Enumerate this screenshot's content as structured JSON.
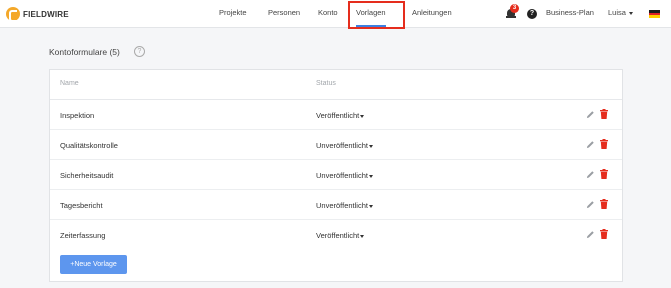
{
  "app": {
    "logo_text": "FIELDWIRE"
  },
  "nav": {
    "items": [
      {
        "label": "Projekte"
      },
      {
        "label": "Personen"
      },
      {
        "label": "Konto"
      },
      {
        "label": "Vorlagen"
      },
      {
        "label": "Anleitungen"
      }
    ],
    "active": "Vorlagen",
    "notification_count": "3",
    "help_label": "?",
    "plan_label": "Business-Plan",
    "user_label": "Luisa"
  },
  "section": {
    "title": "Kontoformulare (5)",
    "info_label": "?"
  },
  "table": {
    "columns": [
      "Name",
      "Status"
    ],
    "rows": [
      {
        "name": "Inspektion",
        "status": "Veröffentlicht"
      },
      {
        "name": "Qualitätskontrolle",
        "status": "Unveröffentlicht"
      },
      {
        "name": "Sicherheitsaudit",
        "status": "Unveröffentlicht"
      },
      {
        "name": "Tagesbericht",
        "status": "Unveröffentlicht"
      },
      {
        "name": "Zeiterfassung",
        "status": "Veröffentlicht"
      }
    ]
  },
  "actions": {
    "add_label": "+Neue Vorlage"
  },
  "icons": {
    "edit": "pencil-icon",
    "delete": "trash-icon",
    "notifications": "bell-icon",
    "language": "german-flag-icon"
  },
  "colors": {
    "accent": "#3d7fe0",
    "button": "#5d96ee",
    "delete": "#e52d1d",
    "highlight": "#e52d1d",
    "brand": "#f4a82a"
  }
}
